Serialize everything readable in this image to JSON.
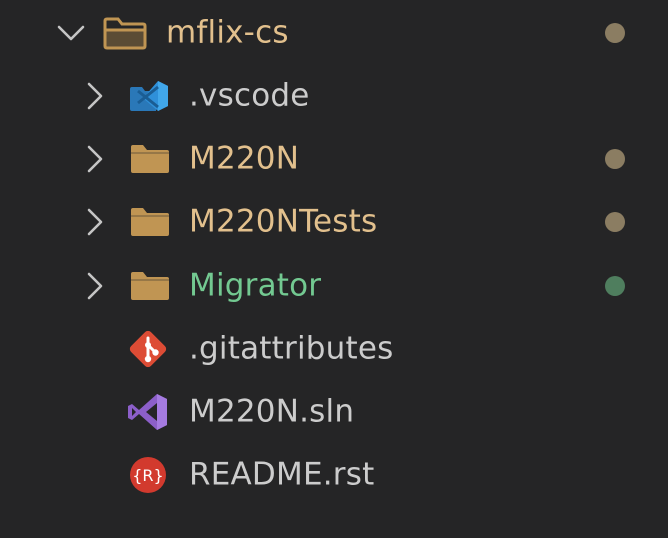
{
  "colors": {
    "background": "#252526",
    "folder_icon": "#c09553",
    "modified_text": "#e2c08d",
    "modified_dot": "#8b7d62",
    "untracked_text": "#73c991",
    "untracked_dot": "#4f7e5e",
    "default_text": "#cccccc",
    "chevron": "#c5c5c5",
    "vscode_blue": "#2f90d9",
    "git_red": "#dd4c35",
    "vs_purple": "#8c5fc9",
    "readme_red": "#d23a2e"
  },
  "explorer": {
    "root": {
      "label": "mflix-cs",
      "icon": "folder-open-icon",
      "expanded": true,
      "git_status": "modified"
    },
    "items": [
      {
        "label": ".vscode",
        "icon": "vscode-folder-icon",
        "kind": "folder",
        "expanded": false,
        "git_status": "none"
      },
      {
        "label": "M220N",
        "icon": "folder-icon",
        "kind": "folder",
        "expanded": false,
        "git_status": "modified"
      },
      {
        "label": "M220NTests",
        "icon": "folder-icon",
        "kind": "folder",
        "expanded": false,
        "git_status": "modified"
      },
      {
        "label": "Migrator",
        "icon": "folder-icon",
        "kind": "folder",
        "expanded": false,
        "git_status": "untracked"
      },
      {
        "label": ".gitattributes",
        "icon": "git-icon",
        "kind": "file",
        "git_status": "none"
      },
      {
        "label": "M220N.sln",
        "icon": "visual-studio-icon",
        "kind": "file",
        "git_status": "none"
      },
      {
        "label": "README.rst",
        "icon": "readme-rst-icon",
        "kind": "file",
        "git_status": "none"
      }
    ]
  }
}
